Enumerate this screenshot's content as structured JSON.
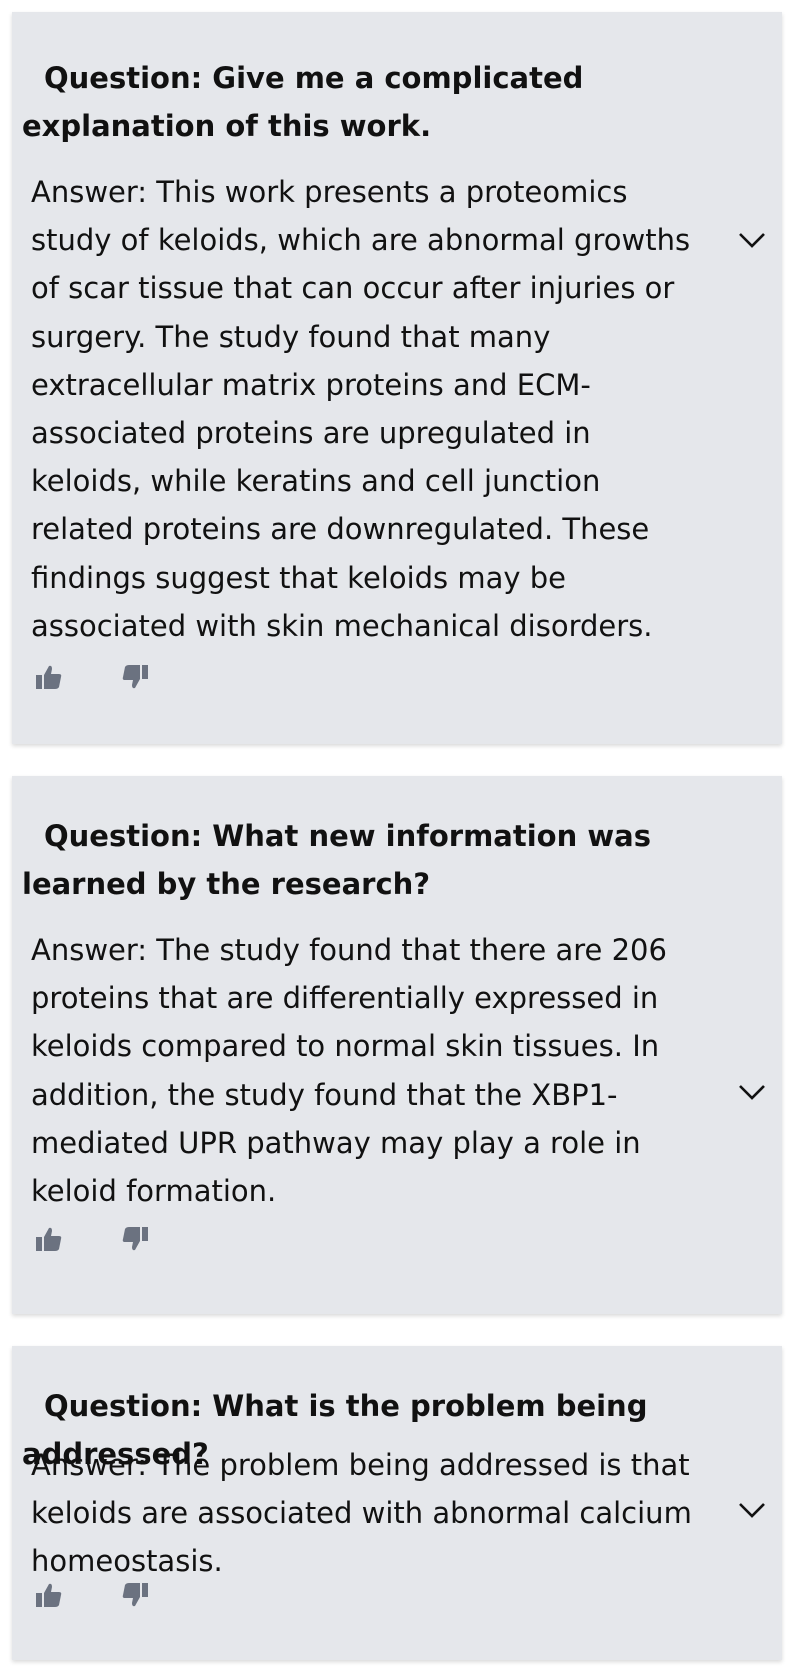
{
  "qa_items": [
    {
      "question": "Question: Give me a complicated explanation of this work.",
      "answer": "Answer: This work presents a proteomics study of keloids, which are abnormal growths of scar tissue that can occur after injuries or surgery. The study found that many extracellular matrix proteins and ECM-associated proteins are upregulated in keloids, while keratins and cell junction related proteins are downregulated. These findings suggest that keloids may be associated with skin mechanical disorders."
    },
    {
      "question": "Question: What new information was learned by the research?",
      "answer": "Answer: The study found that there are 206 proteins that are differentially expressed in keloids compared to normal skin tissues. In addition, the study found that the XBP1-mediated UPR pathway may play a role in keloid formation."
    },
    {
      "question": "Question: What is the problem being addressed?",
      "answer": "Answer: The problem being addressed is that keloids are associated with abnormal calcium homeostasis."
    }
  ],
  "icons": {
    "expand": "chevron-down-icon",
    "upvote": "thumbs-up-icon",
    "downvote": "thumbs-down-icon"
  },
  "colors": {
    "card_background": "#e5e7eb",
    "text": "#111111",
    "icon": "#6b7280"
  }
}
